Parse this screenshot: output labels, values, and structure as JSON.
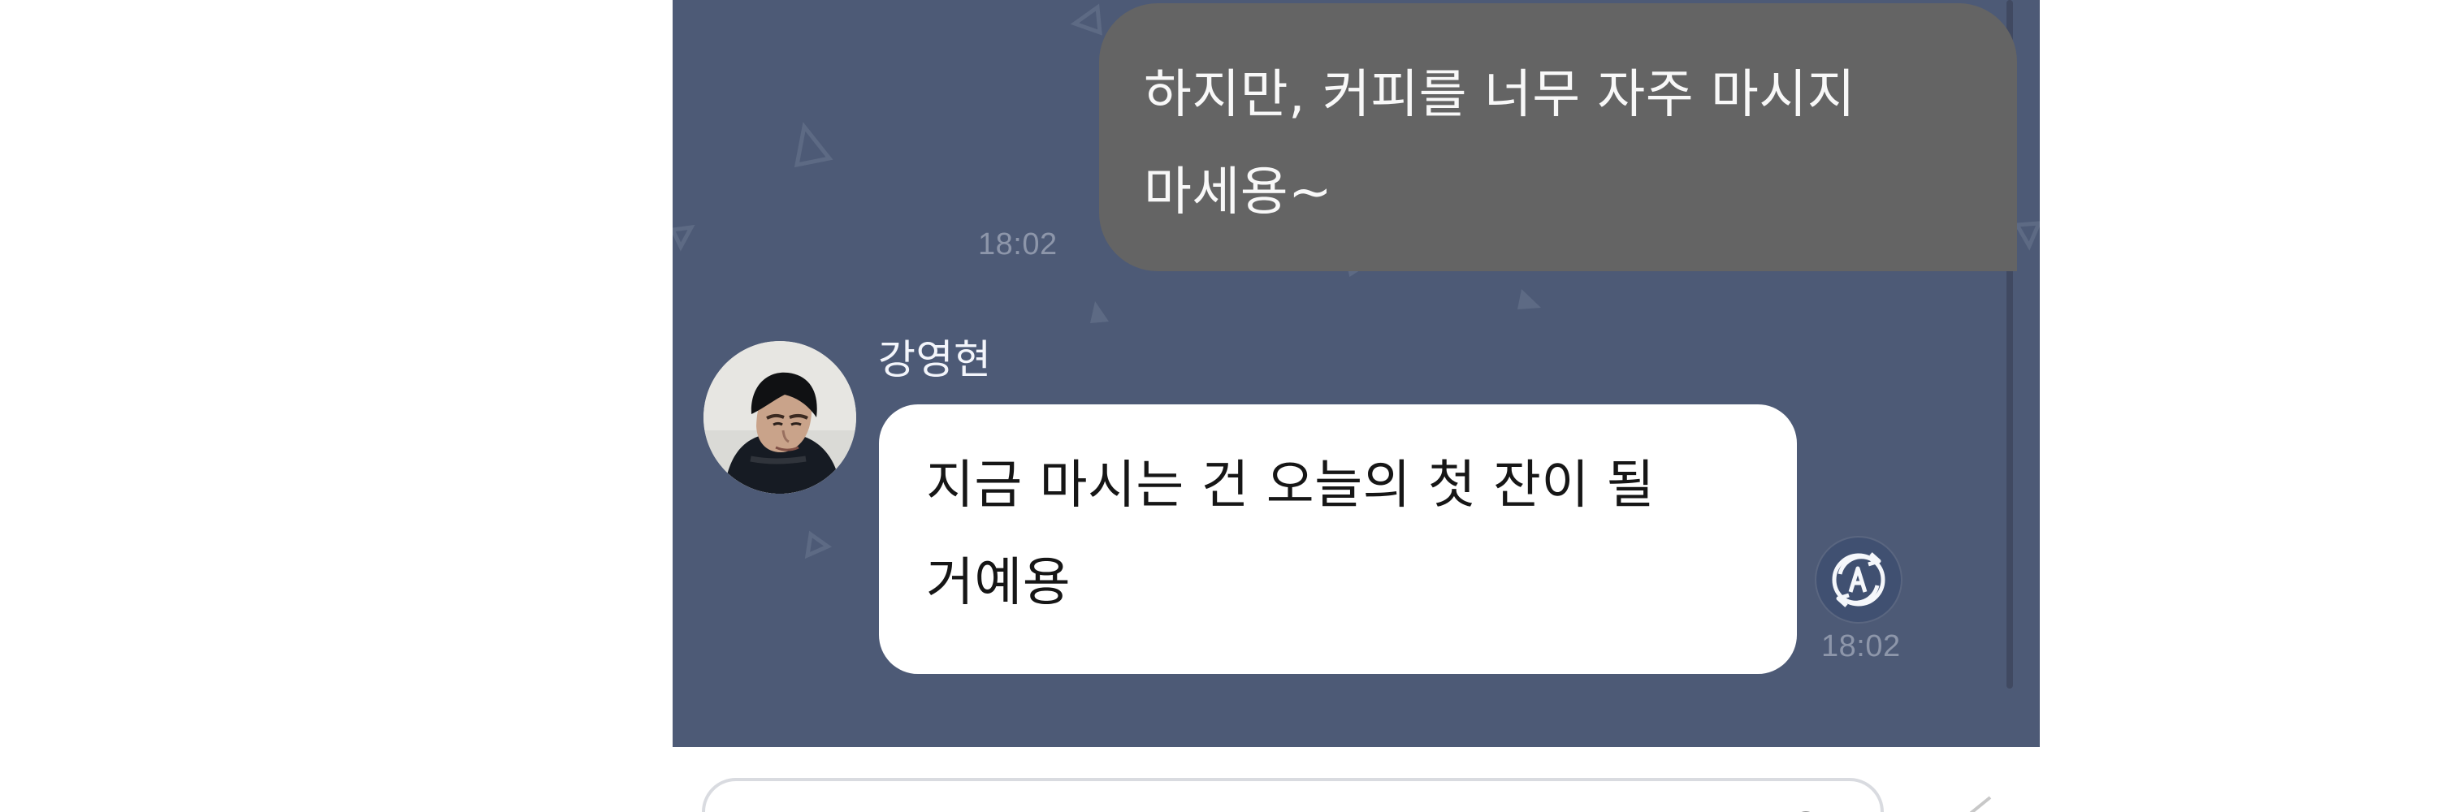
{
  "chat": {
    "messages": [
      {
        "text": "하지만, 커피를 너무 자주 마시지 마세용~",
        "time": "18:02"
      },
      {
        "sender": "강영현",
        "text": "지금 마시는 건 오늘의 첫 잔이 될 거예용",
        "time": "18:02"
      }
    ]
  },
  "icons": {
    "avatar": "profile-photo",
    "translate": "translate-icon",
    "composer": "emoji-icon",
    "send": "send-icon"
  },
  "colors": {
    "chat_background": "#4d5a76",
    "outgoing_bubble": "#646464",
    "incoming_bubble": "#ffffff",
    "timestamp": "#8d96aa"
  }
}
